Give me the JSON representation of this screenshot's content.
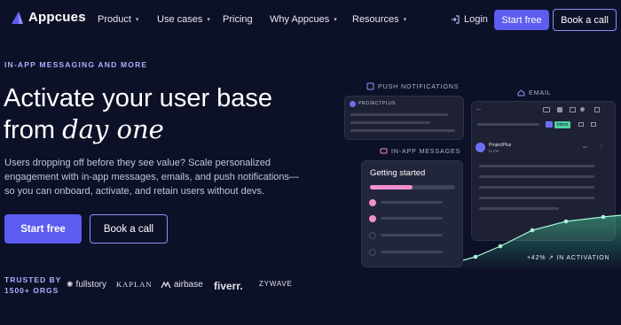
{
  "nav": {
    "logo_text": "Appcues",
    "items": [
      {
        "label": "Product",
        "has_menu": true
      },
      {
        "label": "Use cases",
        "has_menu": true
      },
      {
        "label": "Pricing",
        "has_menu": false
      },
      {
        "label": "Why Appcues",
        "has_menu": true
      },
      {
        "label": "Resources",
        "has_menu": true
      }
    ],
    "login_label": "Login",
    "start_free_label": "Start free",
    "book_call_label": "Book a call"
  },
  "hero": {
    "eyebrow": "IN-APP MESSAGING AND MORE",
    "title_line1": "Activate your user base",
    "title_line2_plain": "from ",
    "title_line2_em": "day one",
    "description": "Users dropping off before they see value? Scale personalized engagement with in-app messages, emails, and push notifications—so you can onboard, activate, and retain users without devs.",
    "cta_primary": "Start free",
    "cta_secondary": "Book a call"
  },
  "trusted": {
    "line1": "TRUSTED BY",
    "line2": "1500+ ORGS",
    "brands": [
      "fullstory",
      "KAPLAN",
      "airbase",
      "fiverr.",
      "ZYWAVE"
    ]
  },
  "illustration": {
    "push_label": "PUSH NOTIFICATIONS",
    "push_sender": "PROJECTPLUS",
    "email_label": "EMAIL",
    "email_tag": "Inbox",
    "email_sender": "ProjectPlus",
    "email_to": "to me",
    "inapp_label": "IN-APP MESSAGES",
    "inapp_title": "Getting started",
    "inapp_progress": 0.5,
    "stat_text": "+42% ↗ IN ACTIVATION",
    "accent_color": "#5c5cf0",
    "pink_color": "#f28fd0",
    "green_color": "#8ff0c6"
  }
}
